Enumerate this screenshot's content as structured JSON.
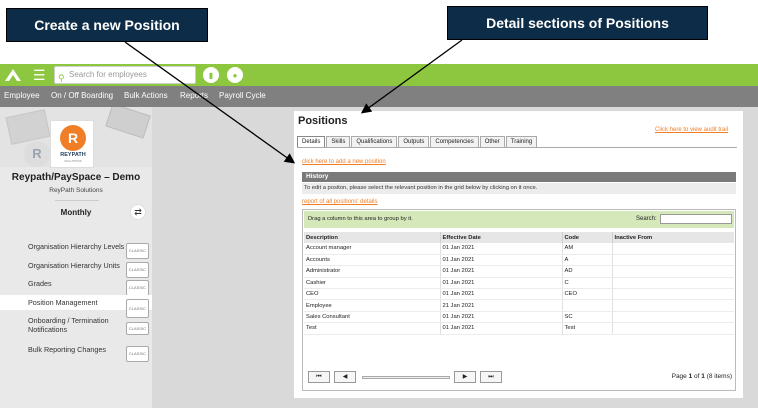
{
  "callouts": {
    "create": "Create a new Position",
    "details": "Detail sections of Positions"
  },
  "topbar": {
    "search_placeholder": "Search for employees"
  },
  "nav": {
    "items": [
      "Employee",
      "On / Off Boarding",
      "Bulk Actions",
      "Reports",
      "Payroll Cycle"
    ]
  },
  "sidebar": {
    "logo_name": "REYPATH",
    "logo_sub": "SOLUTIONS",
    "company_title": "Reypath/PaySpace – Demo",
    "company_sub": "ReyPath Solutions",
    "period": "Monthly",
    "badge": "CLASSIC",
    "items": [
      {
        "label": "Organisation Hierarchy Levels"
      },
      {
        "label": "Organisation Hierarchy Units"
      },
      {
        "label": "Grades"
      },
      {
        "label": "Position Management"
      },
      {
        "label": "Onboarding / Termination Notifications"
      },
      {
        "label": "Bulk Reporting Changes"
      }
    ]
  },
  "panel": {
    "title": "Positions",
    "audit_link": "Click here to view audit trail",
    "tabs": [
      "Details",
      "Skills",
      "Qualifications",
      "Outputs",
      "Competencies",
      "Other",
      "Training"
    ],
    "active_tab": "Details",
    "add_link": "click here to add a new position",
    "history_label": "History",
    "instruction": "To edit a positon, please select the relevant position in the grid below by clicking on it once.",
    "report_link": "report of all positions' details",
    "group_hint": "Drag a column to this area to group by it.",
    "search_label": "Search:",
    "columns": [
      "Description",
      "Effective Date",
      "Code",
      "Inactive From"
    ],
    "rows": [
      [
        "Account manager",
        "01 Jan 2021",
        "AM",
        ""
      ],
      [
        "Accounts",
        "01 Jan 2021",
        "A",
        ""
      ],
      [
        "Administrator",
        "01 Jan 2021",
        "AD",
        ""
      ],
      [
        "Cashier",
        "01 Jan 2021",
        "C",
        ""
      ],
      [
        "CEO",
        "01 Jan 2021",
        "CEO",
        ""
      ],
      [
        "Employee",
        "21 Jan 2021",
        "",
        ""
      ],
      [
        "Sales Consultant",
        "01 Jan 2021",
        "SC",
        ""
      ],
      [
        "Test",
        "01 Jan 2021",
        "Test",
        ""
      ]
    ],
    "pager": {
      "page_word": "Page",
      "current": "1",
      "of_word": "of",
      "total": "1",
      "items": "(8 items)"
    }
  },
  "colors": {
    "topbar": "#8dc63f",
    "navbar": "#808080",
    "callout": "#0d2c47",
    "link": "#f07e26",
    "history_bar": "#7a7a7a",
    "group_header": "#d5e8b9"
  }
}
